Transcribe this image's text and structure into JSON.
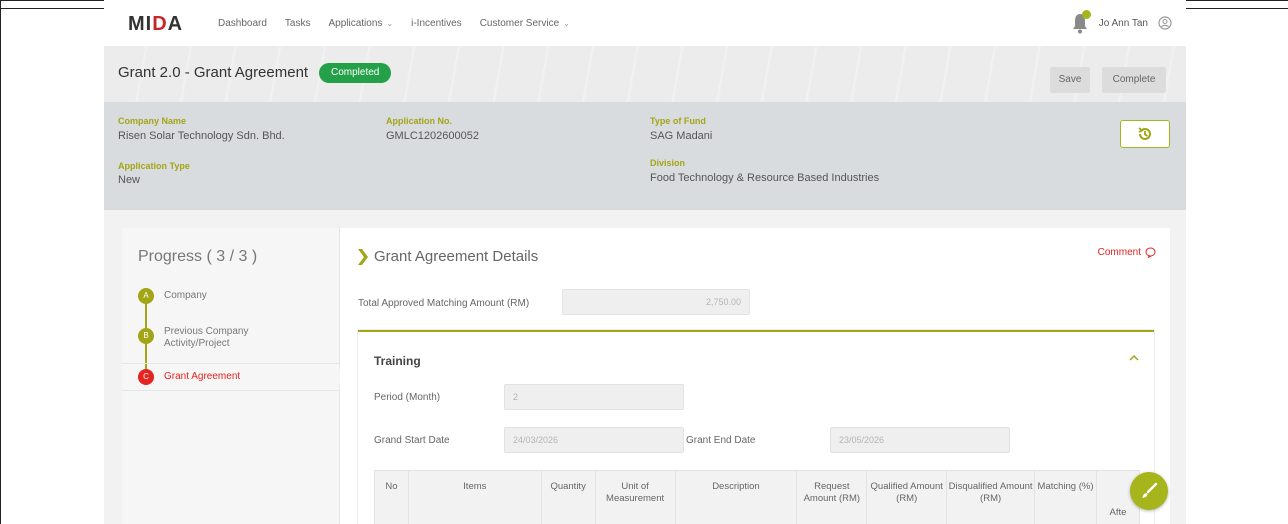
{
  "nav": {
    "logo": "MIDA",
    "items": [
      {
        "label": "Dashboard",
        "has_dropdown": false
      },
      {
        "label": "Tasks",
        "has_dropdown": false
      },
      {
        "label": "Applications",
        "has_dropdown": true
      },
      {
        "label": "i-Incentives",
        "has_dropdown": false
      },
      {
        "label": "Customer Service",
        "has_dropdown": true
      }
    ],
    "user_name": "Jo Ann Tan",
    "notification_icon": "bell-icon",
    "user_icon": "user-circle-icon"
  },
  "header": {
    "title": "Grant 2.0 - Grant Agreement",
    "status": "Completed",
    "save_label": "Save",
    "complete_label": "Complete"
  },
  "info": {
    "company_name_label": "Company Name",
    "company_name": "Risen Solar Technology Sdn. Bhd.",
    "application_no_label": "Application No.",
    "application_no": "GMLC1202600052",
    "type_of_fund_label": "Type of Fund",
    "type_of_fund": "SAG Madani",
    "application_type_label": "Application Type",
    "application_type": "New",
    "division_label": "Division",
    "division": "Food Technology & Resource Based Industries",
    "history_icon": "history-icon"
  },
  "progress": {
    "title": "Progress ( 3 / 3 )",
    "steps": [
      {
        "letter": "A",
        "label": "Company"
      },
      {
        "letter": "B",
        "label": "Previous Company Activity/Project"
      },
      {
        "letter": "C",
        "label": "Grant Agreement"
      }
    ]
  },
  "form": {
    "section_title": "Grant Agreement Details",
    "comment_label": "Comment",
    "total_label": "Total Approved Matching Amount (RM)",
    "total_value": "2,750.00",
    "training": {
      "title": "Training",
      "period_label": "Period (Month)",
      "period_value": "2",
      "start_label": "Grand Start Date",
      "start_value": "24/03/2026",
      "end_label": "Grant End Date",
      "end_value": "23/05/2026",
      "columns": [
        "No",
        "Items",
        "Quantity",
        "Unit of Measurement",
        "Description",
        "Request Amount (RM)",
        "Qualified Amount (RM)",
        "Disqualified Amount (RM)",
        "Matching (%)",
        "Afte"
      ]
    }
  },
  "colors": {
    "accent": "#a2a516",
    "status_green": "#24a148",
    "active_red": "#e52320"
  }
}
